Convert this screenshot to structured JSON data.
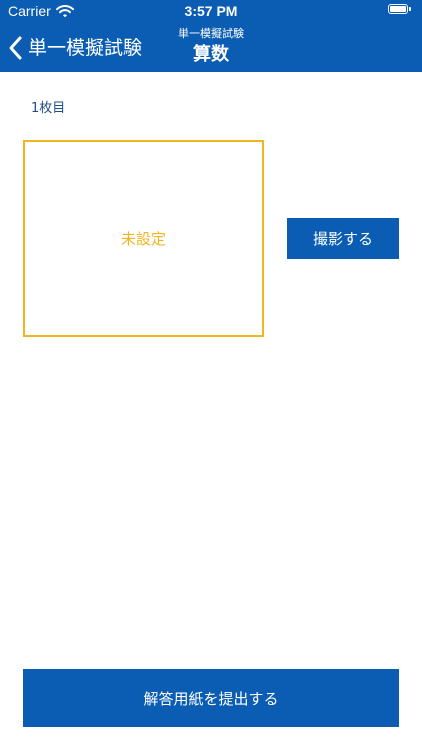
{
  "status_bar": {
    "carrier": "Carrier",
    "time": "3:57 PM",
    "wifi_icon": "wifi-icon",
    "battery_icon": "battery-icon"
  },
  "nav": {
    "back_label": "単一模擬試験",
    "back_icon": "chevron-left-icon",
    "subtitle": "単一模擬試験",
    "title": "算数"
  },
  "sheet": {
    "label": "1枚目",
    "preview_status": "未設定",
    "capture_button_label": "撮影する"
  },
  "footer": {
    "submit_button_label": "解答用紙を提出する"
  },
  "colors": {
    "primary": "#0b5db3",
    "accent_border": "#f1b521",
    "label_text": "#1f4e85",
    "background": "#ffffff"
  }
}
